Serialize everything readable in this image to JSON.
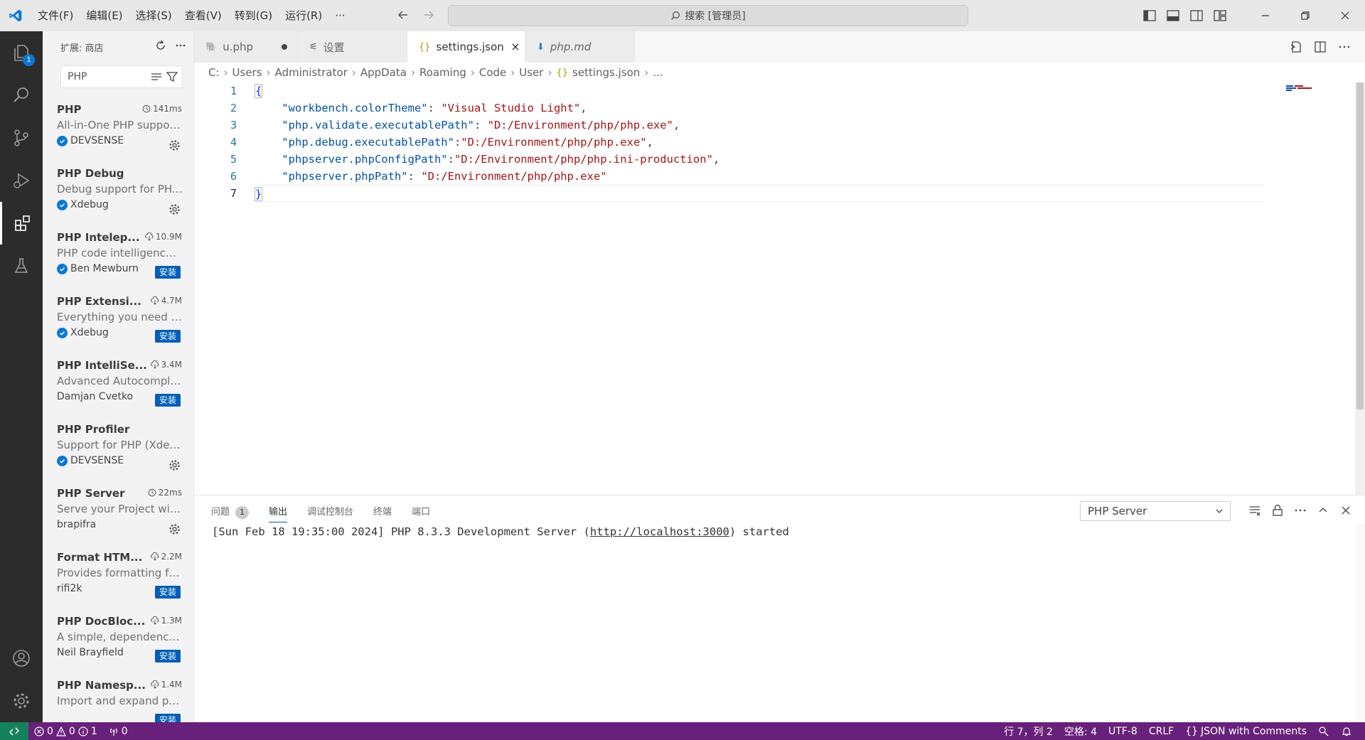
{
  "menu": [
    "文件(F)",
    "编辑(E)",
    "选择(S)",
    "查看(V)",
    "转到(G)",
    "运行(R)",
    "···"
  ],
  "command_center": {
    "label": "搜索 [管理员]"
  },
  "activity_bar": {
    "explorer_badge": "1"
  },
  "sidebar": {
    "title": "扩展: 商店",
    "search_value": "PHP",
    "extensions": [
      {
        "name": "PHP",
        "meta": "141ms",
        "desc": "All-in-One PHP suppor...",
        "publisher": "DEVSENSE",
        "verified": true,
        "action": "gear"
      },
      {
        "name": "PHP Debug",
        "meta": "",
        "desc": "Debug support for PH...",
        "publisher": "Xdebug",
        "verified": true,
        "action": "gear"
      },
      {
        "name": "PHP Intelep...",
        "meta": "10.9M",
        "desc": "PHP code intelligence f...",
        "publisher": "Ben Mewburn",
        "verified": true,
        "action": "安装"
      },
      {
        "name": "PHP Extensi...",
        "meta": "4.7M",
        "desc": "Everything you need fo...",
        "publisher": "Xdebug",
        "verified": true,
        "action": "安装"
      },
      {
        "name": "PHP IntelliSe...",
        "meta": "3.4M",
        "desc": "Advanced Autocomple...",
        "publisher": "Damjan Cvetko",
        "verified": false,
        "action": "安装"
      },
      {
        "name": "PHP Profiler",
        "meta": "",
        "desc": "Support for PHP (Xdeb...",
        "publisher": "DEVSENSE",
        "verified": true,
        "action": "gear"
      },
      {
        "name": "PHP Server",
        "meta": "22ms",
        "desc": "Serve your Project with...",
        "publisher": "brapifra",
        "verified": false,
        "action": "gear"
      },
      {
        "name": "Format HTM...",
        "meta": "2.2M",
        "desc": "Provides formatting for...",
        "publisher": "rifi2k",
        "verified": false,
        "action": "安装"
      },
      {
        "name": "PHP DocBloc...",
        "meta": "1.3M",
        "desc": "A simple, dependency ...",
        "publisher": "Neil Brayfield",
        "verified": false,
        "action": "安装"
      },
      {
        "name": "PHP Namesp...",
        "meta": "1.4M",
        "desc": "Import and expand ph...",
        "publisher": "",
        "verified": false,
        "action": "安装"
      }
    ]
  },
  "tabs": [
    {
      "label": "u.php",
      "icon": "php-icon",
      "dirty": true
    },
    {
      "label": "设置",
      "icon": "settings-editor-icon"
    },
    {
      "label": "settings.json",
      "icon": "json-braces-icon",
      "active": true
    },
    {
      "label": "php.md",
      "icon": "markdown-icon",
      "italic": true
    }
  ],
  "breadcrumb": [
    "C:",
    "Users",
    "Administrator",
    "AppData",
    "Roaming",
    "Code",
    "User",
    "settings.json",
    "..."
  ],
  "editor": {
    "line_numbers": [
      "1",
      "2",
      "3",
      "4",
      "5",
      "6",
      "7"
    ],
    "current_line": 7,
    "lines": [
      [
        {
          "t": "{",
          "c": "br"
        }
      ],
      [
        {
          "t": "    "
        },
        {
          "t": "\"workbench.colorTheme\"",
          "c": "k"
        },
        {
          "t": ": "
        },
        {
          "t": "\"Visual Studio Light\"",
          "c": "s"
        },
        {
          "t": ","
        }
      ],
      [
        {
          "t": "    "
        },
        {
          "t": "\"php.validate.executablePath\"",
          "c": "k"
        },
        {
          "t": ": "
        },
        {
          "t": "\"D:/Environment/php/php.exe\"",
          "c": "s"
        },
        {
          "t": ","
        }
      ],
      [
        {
          "t": "    "
        },
        {
          "t": "\"php.debug.executablePath\"",
          "c": "k"
        },
        {
          "t": ":"
        },
        {
          "t": "\"D:/Environment/php/php.exe\"",
          "c": "s"
        },
        {
          "t": ","
        }
      ],
      [
        {
          "t": "    "
        },
        {
          "t": "\"phpserver.phpConfigPath\"",
          "c": "k"
        },
        {
          "t": ":"
        },
        {
          "t": "\"D:/Environment/php/php.ini-production\"",
          "c": "s"
        },
        {
          "t": ","
        }
      ],
      [
        {
          "t": "    "
        },
        {
          "t": "\"phpserver.phpPath\"",
          "c": "k"
        },
        {
          "t": ": "
        },
        {
          "t": "\"D:/Environment/php/php.exe\"",
          "c": "s"
        }
      ],
      [
        {
          "t": "}",
          "c": "br"
        }
      ]
    ]
  },
  "panel": {
    "tabs": [
      "问题",
      "输出",
      "调试控制台",
      "终端",
      "端口"
    ],
    "problems_count": "1",
    "active_tab": "输出",
    "channel": "PHP Server",
    "output_prefix": "[Sun Feb 18 19:35:00 2024] PHP 8.3.3 Development Server (",
    "output_link": "http://localhost:3000",
    "output_suffix": ") started"
  },
  "status": {
    "errors": "0",
    "warnings": "0",
    "infos": "1",
    "ports": "0",
    "position": "行 7，列 2",
    "spaces": "空格: 4",
    "encoding": "UTF-8",
    "eol": "CRLF",
    "language": "JSON with Comments"
  },
  "colors": {
    "accent": "#005fb8",
    "statusbar": "#68217a",
    "remote": "#16825d"
  }
}
